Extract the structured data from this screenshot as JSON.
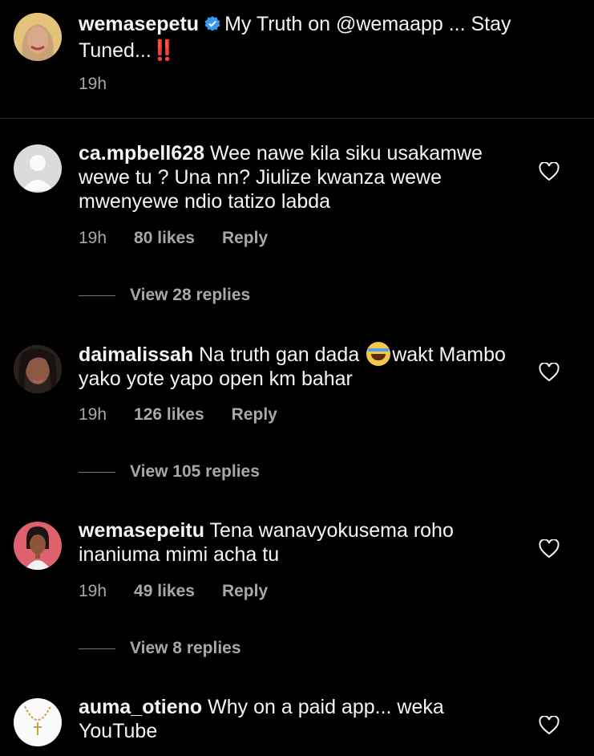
{
  "post": {
    "username": "wemasepetu",
    "caption": "My Truth on @wemaapp ... Stay Tuned...",
    "emphasis": "‼️",
    "time": "19h"
  },
  "comments": [
    {
      "username": "ca.mpbell628",
      "text": "Wee nawe kila siku usakamwe wewe tu ? Una nn? Jiulize kwanza wewe mwenyewe ndio tatizo labda",
      "time": "19h",
      "likes": "80 likes",
      "reply": "Reply",
      "view_replies": "View 28 replies"
    },
    {
      "username": "daimalissah",
      "text_before": "Na truth gan dada",
      "text_after": "wakt Mambo yako yote yapo open km bahar",
      "time": "19h",
      "likes": "126 likes",
      "reply": "Reply",
      "view_replies": "View 105 replies"
    },
    {
      "username": "wemasepeitu",
      "text": "Tena wanavyokusema roho inaniuma mimi acha tu",
      "time": "19h",
      "likes": "49 likes",
      "reply": "Reply",
      "view_replies": "View 8 replies"
    },
    {
      "username": "auma_otieno",
      "text": "Why on a paid app... weka YouTube"
    }
  ],
  "colors": {
    "background": "#000000",
    "muted": "#a8a8a8",
    "verified": "#3897f0",
    "alert": "#ed2d2d"
  }
}
